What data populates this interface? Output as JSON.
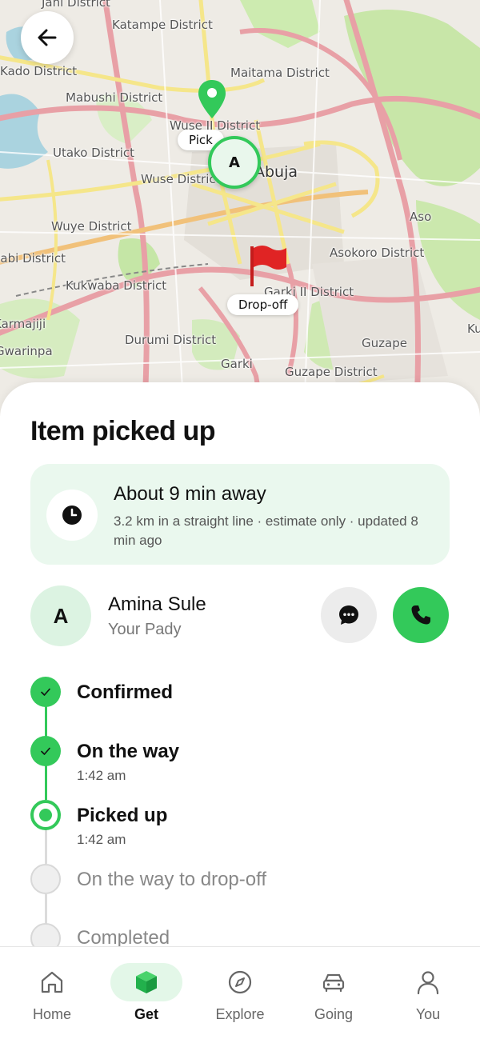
{
  "map": {
    "districts": [
      {
        "name": "Jahi District"
      },
      {
        "name": "Katampe District"
      },
      {
        "name": "Kado District"
      },
      {
        "name": "Maitama District"
      },
      {
        "name": "Mabushi District"
      },
      {
        "name": "Wuse II District"
      },
      {
        "name": "Utako District"
      },
      {
        "name": "Wuse District"
      },
      {
        "name": "Abuja"
      },
      {
        "name": "Aso"
      },
      {
        "name": "Wuye District"
      },
      {
        "name": "Asokoro District"
      },
      {
        "name": "Jabi District"
      },
      {
        "name": "Kukwaba District"
      },
      {
        "name": "Garki II District"
      },
      {
        "name": "Karmajiji"
      },
      {
        "name": "Ku"
      },
      {
        "name": "Durumi District"
      },
      {
        "name": "Guzape"
      },
      {
        "name": "Gwarinpa"
      },
      {
        "name": "Garki"
      },
      {
        "name": "Guzape District"
      }
    ],
    "pickup_label": "Pick",
    "dropoff_label": "Drop-off",
    "courier_initial": "A"
  },
  "status": {
    "title": "Item picked up"
  },
  "eta": {
    "title": "About 9 min away",
    "note": "3.2 km in a straight line · estimate only · updated 8 min ago"
  },
  "driver": {
    "initial": "A",
    "name": "Amina Sule",
    "role": "Your Pady"
  },
  "timeline": [
    {
      "label": "Confirmed",
      "time": "",
      "state": "done"
    },
    {
      "label": "On the way",
      "time": "1:42 am",
      "state": "done"
    },
    {
      "label": "Picked up",
      "time": "1:42 am",
      "state": "current"
    },
    {
      "label": "On the way to drop-off",
      "time": "",
      "state": "pending"
    },
    {
      "label": "Completed",
      "time": "",
      "state": "pending"
    }
  ],
  "nav": [
    {
      "label": "Home",
      "icon": "home-icon",
      "active": false
    },
    {
      "label": "Get",
      "icon": "box-icon",
      "active": true
    },
    {
      "label": "Explore",
      "icon": "compass-icon",
      "active": false
    },
    {
      "label": "Going",
      "icon": "car-icon",
      "active": false
    },
    {
      "label": "You",
      "icon": "user-icon",
      "active": false
    }
  ],
  "colors": {
    "accent": "#33c95a",
    "accent_light": "#eaf8ee",
    "map_background": "#eeebe5",
    "dropoff_flag": "#e02424"
  }
}
